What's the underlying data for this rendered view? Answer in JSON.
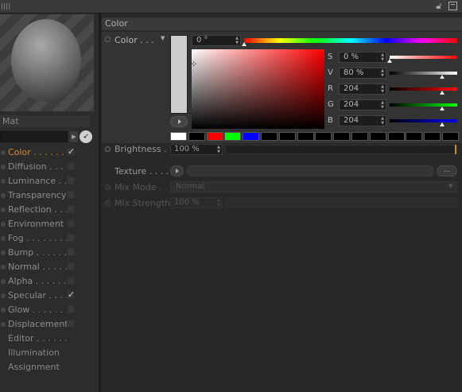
{
  "window": {
    "header_icons": [
      "lock-icon",
      "window-icon"
    ]
  },
  "material": {
    "name": "Mat"
  },
  "channels": [
    {
      "label": "Color . . . . . .",
      "checked": true,
      "active": true
    },
    {
      "label": "Diffusion . . . .",
      "checked": false
    },
    {
      "label": "Luminance . . .",
      "checked": false
    },
    {
      "label": "Transparency",
      "checked": false
    },
    {
      "label": "Reflection . . . .",
      "checked": false
    },
    {
      "label": "Environment",
      "checked": false
    },
    {
      "label": "Fog . . . . . . . .",
      "checked": false
    },
    {
      "label": "Bump . . . . . . .",
      "checked": false
    },
    {
      "label": "Normal . . . . . .",
      "checked": false
    },
    {
      "label": "Alpha . . . . . . .",
      "checked": false
    },
    {
      "label": "Specular . . . .",
      "checked": true
    },
    {
      "label": "Glow . . . . . . .",
      "checked": false
    },
    {
      "label": "Displacement",
      "checked": false
    }
  ],
  "extra_items": [
    "Editor . . . . . .",
    "Illumination",
    "Assignment"
  ],
  "panel": {
    "title": "Color",
    "color_label": "Color . . .",
    "hue_value": "0 °",
    "hue_fraction": 0,
    "components": [
      {
        "label": "S",
        "value": "0 %",
        "fraction": 0.0,
        "gradient": "linear-gradient(90deg,#ffffff,#ff0000)"
      },
      {
        "label": "V",
        "value": "80 %",
        "fraction": 0.8,
        "gradient": "linear-gradient(90deg,#000000,#ffffff)"
      },
      {
        "label": "R",
        "value": "204",
        "fraction": 0.8,
        "gradient": "linear-gradient(90deg,#000000,#ff0000)"
      },
      {
        "label": "G",
        "value": "204",
        "fraction": 0.8,
        "gradient": "linear-gradient(90deg,#000000,#00ff00)"
      },
      {
        "label": "B",
        "value": "204",
        "fraction": 0.8,
        "gradient": "linear-gradient(90deg,#000000,#0000ff)"
      }
    ],
    "presets": [
      "#ffffff",
      "#000000",
      "#ff0000",
      "#00ff00",
      "#0000ff",
      "#000000",
      "#000000",
      "#000000",
      "#000000",
      "#000000",
      "#000000",
      "#000000",
      "#000000",
      "#000000",
      "#000000",
      "#000000"
    ],
    "brightness_label": "Brightness . .",
    "brightness_value": "100 %",
    "texture_label": "Texture . . . . .",
    "texture_more": "...",
    "mix_mode_label": "Mix Mode . .",
    "mix_mode_value": "Normal",
    "mix_strength_label": "Mix Strength",
    "mix_strength_value": "100 %"
  },
  "colors": {
    "accent": "#d88a33",
    "color_swatch": "#cccccc"
  }
}
